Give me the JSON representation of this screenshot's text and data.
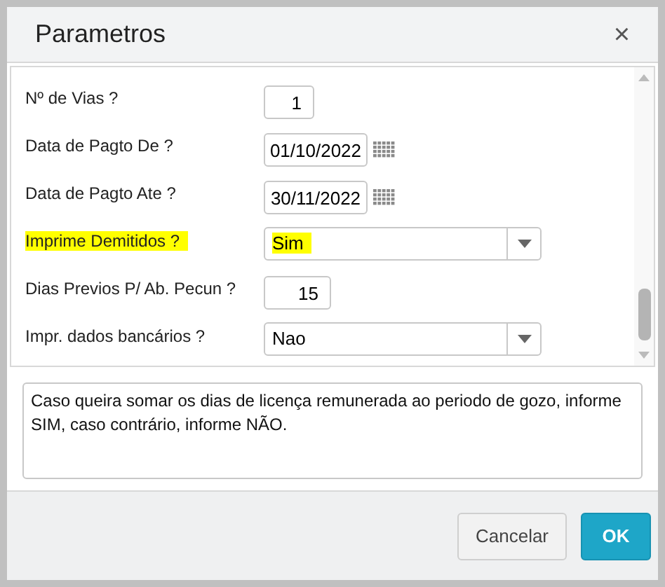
{
  "window": {
    "title": "Parametros",
    "close": "×"
  },
  "params": [
    {
      "label": "Nº de Vias ?",
      "kind": "number",
      "value": "1",
      "focused": false
    },
    {
      "label": "Data de Pagto De ?",
      "kind": "date",
      "value": "01/10/2022",
      "focused": false
    },
    {
      "label": "Data de Pagto Ate ?",
      "kind": "date",
      "value": "30/11/2022",
      "focused": false
    },
    {
      "label": "Imprime Demitidos ?",
      "kind": "select",
      "value": "Sim",
      "focused": true
    },
    {
      "label": "Dias Previos P/ Ab. Pecun ?",
      "kind": "number2",
      "value": "15",
      "focused": false
    },
    {
      "label": "Impr. dados bancários ?",
      "kind": "select",
      "value": "Nao",
      "focused": false
    }
  ],
  "help": "Caso queira somar os dias de licença remunerada ao periodo de gozo, informe SIM, caso contrário, informe NÃO.",
  "buttons": [
    {
      "label": "Cancelar",
      "kind": "secondary"
    },
    {
      "label": "OK",
      "kind": "primary"
    }
  ]
}
